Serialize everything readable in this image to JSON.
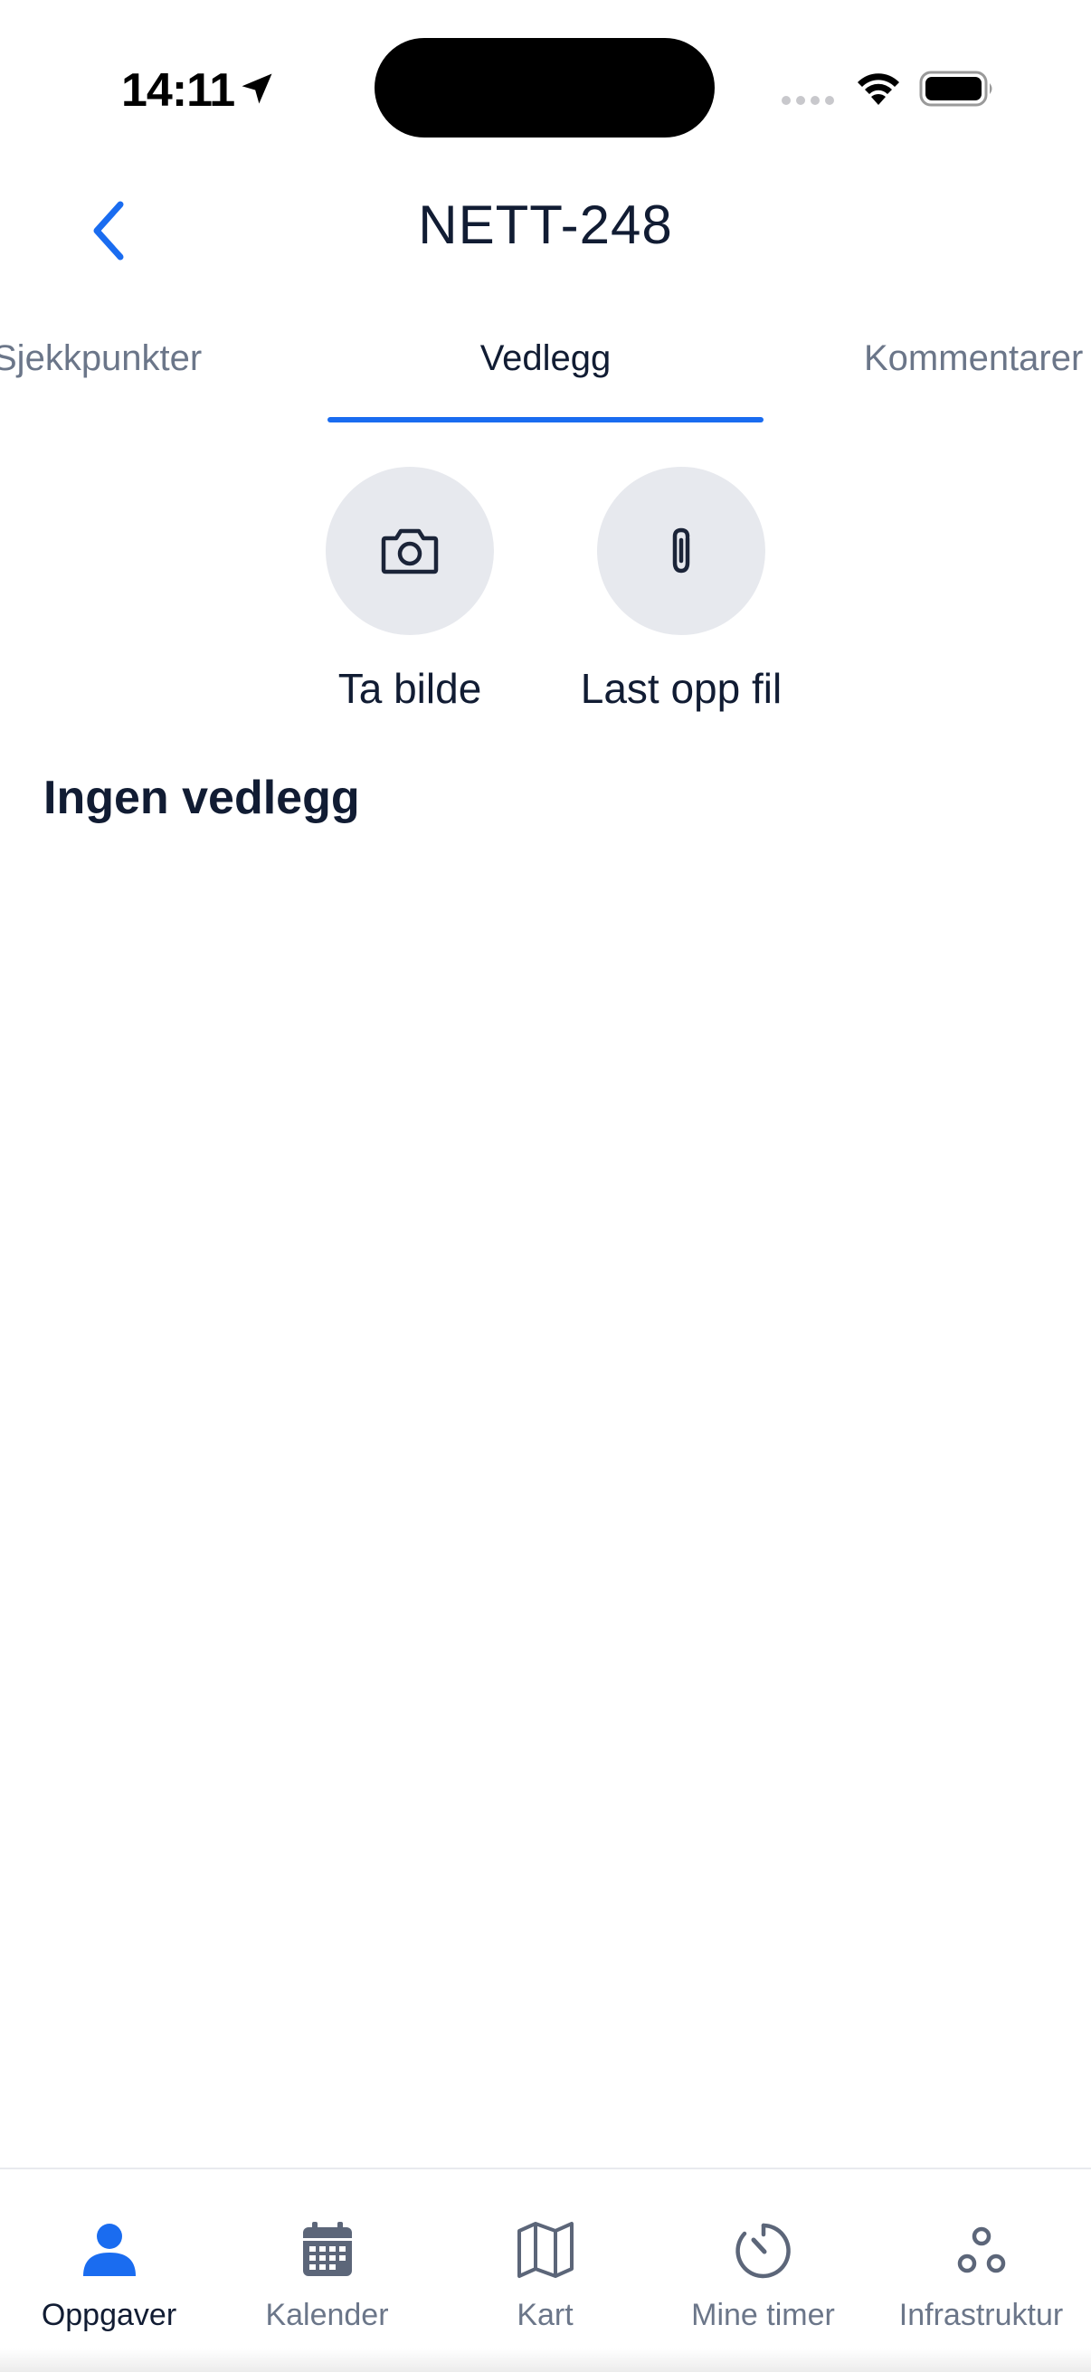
{
  "status_bar": {
    "time": "14:11",
    "icons": [
      "location-arrow-icon",
      "cellular-signal-icon",
      "wifi-icon",
      "battery-icon"
    ]
  },
  "header": {
    "title": "NETT-248",
    "back_icon": "chevron-left-icon"
  },
  "tabs": [
    {
      "label": "Sjekkpunkter",
      "active": false
    },
    {
      "label": "Vedlegg",
      "active": true
    },
    {
      "label": "Kommentarer",
      "active": false
    }
  ],
  "actions": [
    {
      "label": "Ta bilde",
      "icon": "camera-icon"
    },
    {
      "label": "Last opp fil",
      "icon": "paperclip-icon"
    }
  ],
  "attachments": {
    "empty_text": "Ingen vedlegg"
  },
  "bottom_nav": [
    {
      "label": "Oppgaver",
      "icon": "person-icon",
      "active": true
    },
    {
      "label": "Kalender",
      "icon": "calendar-icon",
      "active": false
    },
    {
      "label": "Kart",
      "icon": "map-icon",
      "active": false
    },
    {
      "label": "Mine timer",
      "icon": "timer-icon",
      "active": false
    },
    {
      "label": "Infrastruktur",
      "icon": "nodes-icon",
      "active": false
    }
  ],
  "colors": {
    "accent": "#1a6cf0",
    "text_primary": "#111c33",
    "text_muted": "#6b7689",
    "action_circle_bg": "#e7e9ee"
  }
}
